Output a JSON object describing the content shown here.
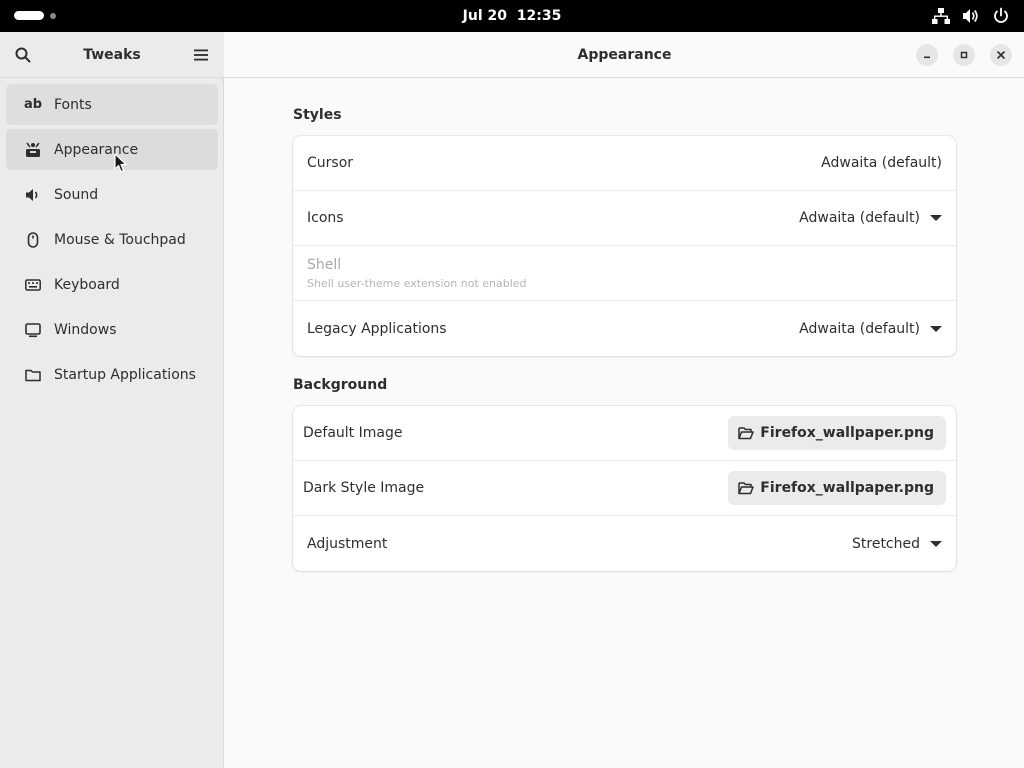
{
  "topbar": {
    "date": "Jul 20",
    "time": "12:35",
    "icons": [
      "network-icon",
      "volume-icon",
      "power-icon"
    ]
  },
  "sidebar": {
    "title": "Tweaks",
    "items": [
      {
        "label": "Fonts",
        "icon": "ab"
      },
      {
        "label": "Appearance",
        "icon": "appearance-icon"
      },
      {
        "label": "Sound",
        "icon": "speaker-icon"
      },
      {
        "label": "Mouse & Touchpad",
        "icon": "mouse-icon"
      },
      {
        "label": "Keyboard",
        "icon": "keyboard-icon"
      },
      {
        "label": "Windows",
        "icon": "monitor-icon"
      },
      {
        "label": "Startup Applications",
        "icon": "folder-icon"
      }
    ]
  },
  "main": {
    "title": "Appearance",
    "styles": {
      "heading": "Styles",
      "cursor": {
        "label": "Cursor",
        "value": "Adwaita (default)"
      },
      "icons": {
        "label": "Icons",
        "value": "Adwaita (default)"
      },
      "shell": {
        "label": "Shell",
        "sublabel": "Shell user-theme extension not enabled"
      },
      "legacy": {
        "label": "Legacy Applications",
        "value": "Adwaita (default)"
      }
    },
    "background": {
      "heading": "Background",
      "default_image": {
        "label": "Default Image",
        "value": "Firefox_wallpaper.png"
      },
      "dark_image": {
        "label": "Dark Style Image",
        "value": "Firefox_wallpaper.png"
      },
      "adjustment": {
        "label": "Adjustment",
        "value": "Stretched"
      }
    }
  },
  "colors": {
    "topbar": "#000000",
    "sidebar_bg": "#ebebeb",
    "content_bg": "#fafafa",
    "selected_item": "#dcdcdc"
  }
}
